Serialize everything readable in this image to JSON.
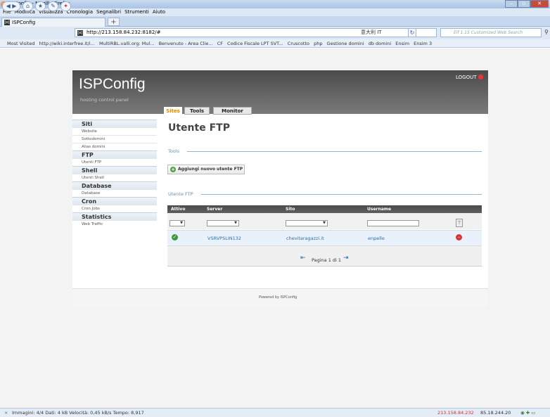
{
  "window": {
    "title": "ISPConfig - Mozilla Firefox"
  },
  "menu": [
    "File",
    "Modifica",
    "Visualizza",
    "Cronologia",
    "Segnalibri",
    "Strumenti",
    "Aiuto"
  ],
  "tab": {
    "label": "ISPConfig",
    "fav": "[e]"
  },
  "nav": {
    "url": "http://213.158.84.232:8182/#",
    "url_extra": "意大利 IT",
    "search_placeholder": "Elf 1.15 Customized Web Search"
  },
  "bookmarks": [
    "Most Visited",
    "http://wiki.interfree.it/i...",
    "MultiRBL.valli.org: Mul...",
    "Benvenuto - Area Clie...",
    "CF",
    "Codice Fiscale LPT SVT...",
    "Cruscotto",
    "php",
    "Gestione domini",
    "db domini",
    "Ensim",
    "Ensim 3"
  ],
  "header": {
    "logo": "ISPConfig",
    "subtitle": "hosting control panel",
    "logout": "LOGOUT"
  },
  "main_tabs": [
    "Sites",
    "Tools",
    "Monitor"
  ],
  "sidebar": [
    {
      "heading": "Siti",
      "items": [
        "Website",
        "Sottodomini",
        "Alias domini"
      ]
    },
    {
      "heading": "FTP",
      "items": [
        "Utenti FTP"
      ]
    },
    {
      "heading": "Shell",
      "items": [
        "Utenti Shell"
      ]
    },
    {
      "heading": "Database",
      "items": [
        "Database"
      ]
    },
    {
      "heading": "Cron",
      "items": [
        "Cron Jobs"
      ]
    },
    {
      "heading": "Statistics",
      "items": [
        "Web Traffic"
      ]
    }
  ],
  "content": {
    "title": "Utente FTP",
    "tools_legend": "Tools",
    "add_button": "Aggiungi nuovo utente FTP",
    "list_legend": "Utente FTP",
    "columns": [
      "Attivo",
      "Server",
      "Sito",
      "Username"
    ],
    "rows": [
      {
        "active": true,
        "server": "VSRVPSLIN132",
        "site": "chevitaragazzi.it",
        "username": "enpelle"
      }
    ],
    "pager": "Pagina 1 di 1"
  },
  "footer": {
    "text": "Powered by ISPConfig"
  },
  "statusbar": {
    "left": "Immagini: 4/4   Dati: 4 kB   Velocità: 0,45 kB/s   Tempo: 8,917",
    "ip1": "213.158.84.232",
    "ip2": "85.18.244.20"
  }
}
